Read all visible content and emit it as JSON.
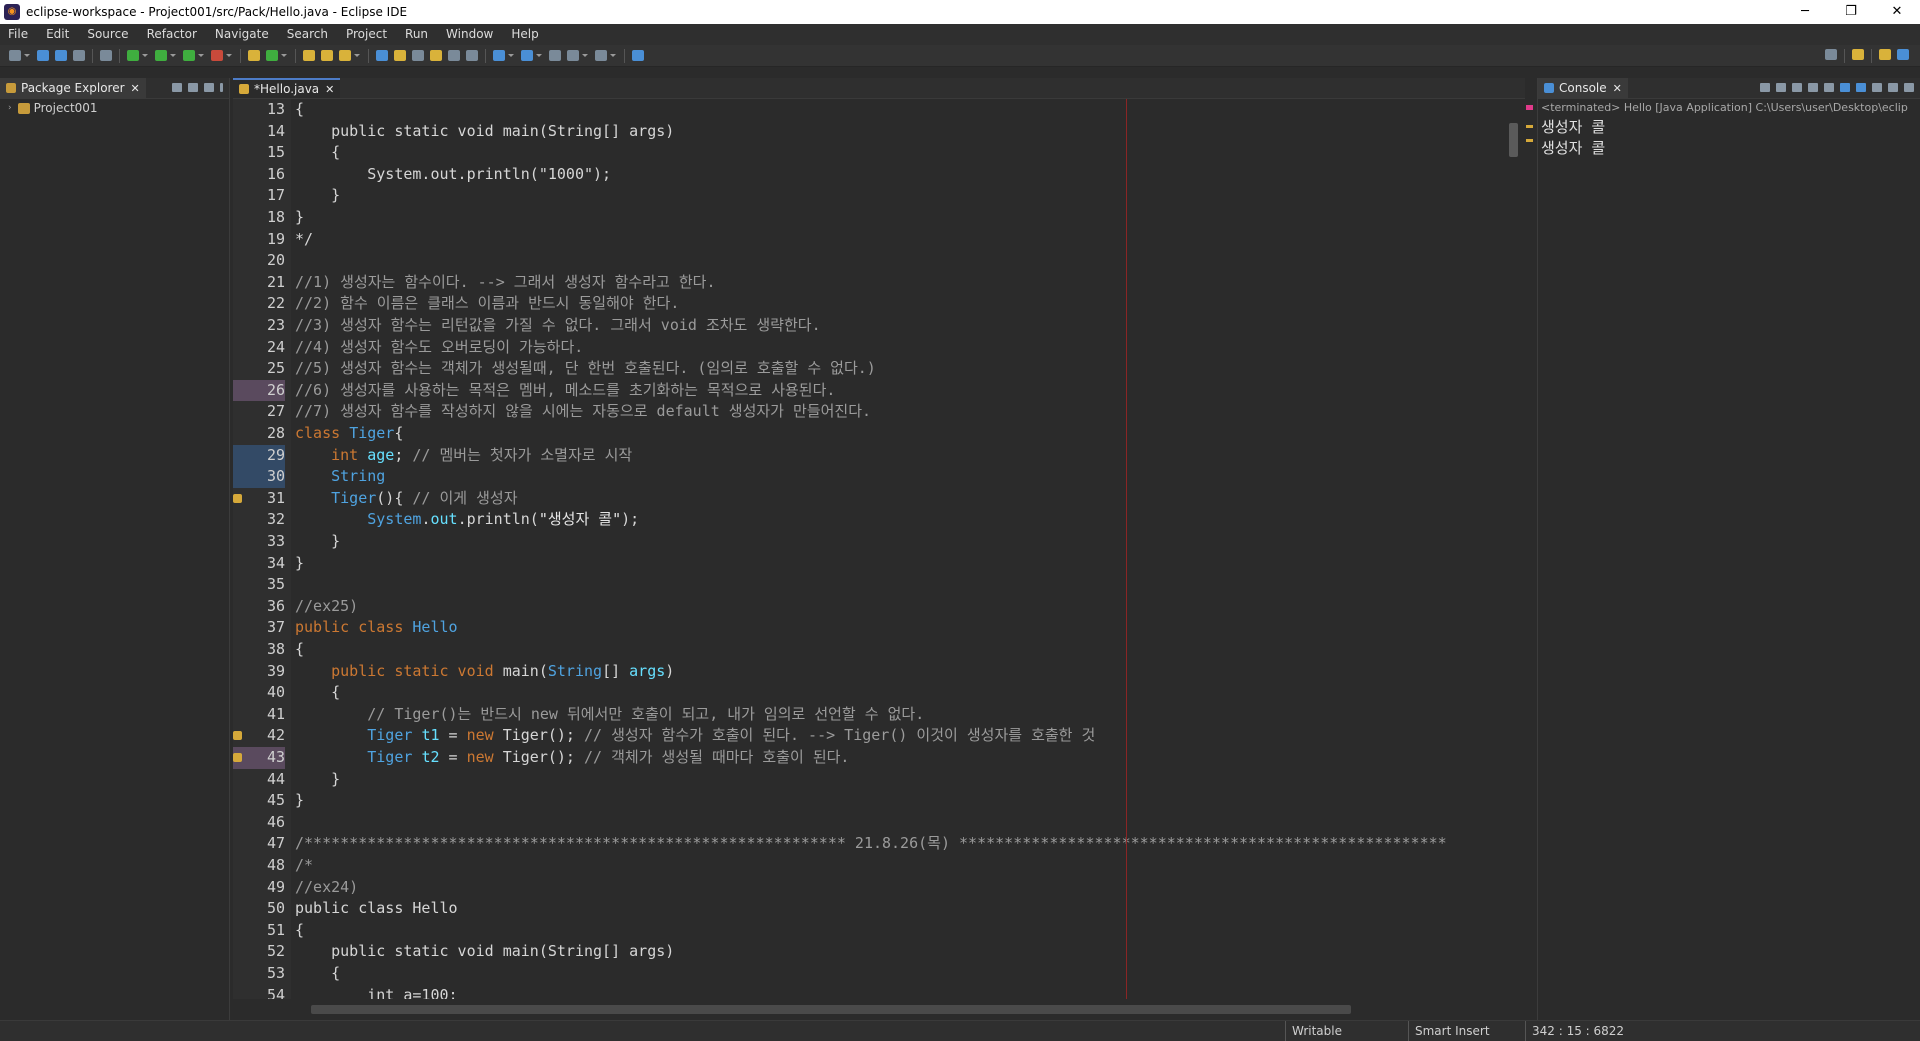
{
  "window": {
    "title": "eclipse-workspace - Project001/src/Pack/Hello.java - Eclipse IDE",
    "min": "─",
    "restore": "❐",
    "close": "✕"
  },
  "menu": [
    "File",
    "Edit",
    "Source",
    "Refactor",
    "Navigate",
    "Search",
    "Project",
    "Run",
    "Window",
    "Help"
  ],
  "package_explorer": {
    "tab_label": "Package Explorer",
    "close": "✕",
    "items": [
      {
        "label": "Project001",
        "arrow": "›"
      }
    ]
  },
  "editor": {
    "tab_label": "*Hello.java",
    "close": "✕",
    "lines": [
      {
        "n": "13",
        "tokens": [
          [
            "plain",
            "{"
          ]
        ]
      },
      {
        "n": "14",
        "tokens": [
          [
            "plain",
            "    public static void main(String[] args)"
          ]
        ]
      },
      {
        "n": "15",
        "tokens": [
          [
            "plain",
            "    {"
          ]
        ]
      },
      {
        "n": "16",
        "tokens": [
          [
            "plain",
            "        System.out.println(\"1000\");"
          ]
        ]
      },
      {
        "n": "17",
        "tokens": [
          [
            "plain",
            "    }"
          ]
        ]
      },
      {
        "n": "18",
        "tokens": [
          [
            "plain",
            "}"
          ]
        ]
      },
      {
        "n": "19",
        "tokens": [
          [
            "plain",
            "*/"
          ]
        ]
      },
      {
        "n": "20",
        "tokens": []
      },
      {
        "n": "21",
        "tokens": [
          [
            "cm",
            "//1) 생성자는 함수이다. --> 그래서 생성자 함수라고 한다."
          ]
        ]
      },
      {
        "n": "22",
        "tokens": [
          [
            "cm",
            "//2) 함수 이름은 클래스 이름과 반드시 동일해야 한다."
          ]
        ]
      },
      {
        "n": "23",
        "tokens": [
          [
            "cm",
            "//3) 생성자 함수는 리턴값을 가질 수 없다. 그래서 void 조차도 생략한다."
          ]
        ]
      },
      {
        "n": "24",
        "tokens": [
          [
            "cm",
            "//4) 생성자 함수도 오버로딩이 가능하다."
          ]
        ]
      },
      {
        "n": "25",
        "tokens": [
          [
            "cm",
            "//5) 생성자 함수는 객체가 생성될때, 단 한번 호출된다. (임의로 호출할 수 없다.)"
          ]
        ]
      },
      {
        "n": "26",
        "hl": "hl",
        "tokens": [
          [
            "cm",
            "//6) 생성자를 사용하는 목적은 멤버, 메소드를 초기화하는 목적으로 사용된다."
          ]
        ]
      },
      {
        "n": "27",
        "tokens": [
          [
            "cm",
            "//7) 생성자 함수를 작성하지 않을 시에는 자동으로 default 생성자가 만들어진다."
          ]
        ]
      },
      {
        "n": "28",
        "tokens": [
          [
            "kw",
            "class "
          ],
          [
            "cls",
            "Tiger"
          ],
          [
            "plain",
            "{"
          ]
        ]
      },
      {
        "n": "29",
        "hl": "hl2",
        "tokens": [
          [
            "plain",
            "    "
          ],
          [
            "kw",
            "int "
          ],
          [
            "fld",
            "age"
          ],
          [
            "plain",
            "; "
          ],
          [
            "cm",
            "// 멤버는 첫자가 소멸자로 시작"
          ]
        ]
      },
      {
        "n": "30",
        "hl": "hl2",
        "tokens": [
          [
            "plain",
            "    "
          ],
          [
            "cls",
            "String"
          ]
        ]
      },
      {
        "n": "31",
        "ann": true,
        "tokens": [
          [
            "plain",
            "    "
          ],
          [
            "cls",
            "Tiger"
          ],
          [
            "plain",
            "(){ "
          ],
          [
            "cm",
            "// 이게 생성자"
          ]
        ]
      },
      {
        "n": "32",
        "tokens": [
          [
            "plain",
            "        "
          ],
          [
            "cls",
            "System"
          ],
          [
            "plain",
            "."
          ],
          [
            "fld",
            "out"
          ],
          [
            "plain",
            ".println("
          ],
          [
            "str",
            "\"생성자 콜\""
          ],
          [
            "plain",
            ");"
          ]
        ]
      },
      {
        "n": "33",
        "tokens": [
          [
            "plain",
            "    }"
          ]
        ]
      },
      {
        "n": "34",
        "tokens": [
          [
            "plain",
            "}"
          ]
        ]
      },
      {
        "n": "35",
        "tokens": []
      },
      {
        "n": "36",
        "tokens": [
          [
            "cm",
            "//ex25)"
          ]
        ]
      },
      {
        "n": "37",
        "tokens": [
          [
            "kw",
            "public class "
          ],
          [
            "cls",
            "Hello"
          ]
        ]
      },
      {
        "n": "38",
        "tokens": [
          [
            "plain",
            "{"
          ]
        ]
      },
      {
        "n": "39",
        "tokens": [
          [
            "plain",
            "    "
          ],
          [
            "kw",
            "public static void "
          ],
          [
            "plain",
            "main("
          ],
          [
            "cls",
            "String"
          ],
          [
            "plain",
            "[] "
          ],
          [
            "fld",
            "args"
          ],
          [
            "plain",
            ")"
          ]
        ]
      },
      {
        "n": "40",
        "tokens": [
          [
            "plain",
            "    {"
          ]
        ]
      },
      {
        "n": "41",
        "tokens": [
          [
            "plain",
            "        "
          ],
          [
            "cm",
            "// Tiger()는 반드시 new 뒤에서만 호출이 되고, 내가 임의로 선언할 수 없다."
          ]
        ]
      },
      {
        "n": "42",
        "ann": true,
        "tokens": [
          [
            "plain",
            "        "
          ],
          [
            "cls",
            "Tiger "
          ],
          [
            "fld",
            "t1"
          ],
          [
            "plain",
            " = "
          ],
          [
            "kw",
            "new "
          ],
          [
            "plain",
            "Tiger(); "
          ],
          [
            "cm",
            "// 생성자 함수가 호출이 된다. --> Tiger() 이것이 생성자를 호출한 것"
          ]
        ]
      },
      {
        "n": "43",
        "hl": "hl",
        "ann": true,
        "tokens": [
          [
            "plain",
            "        "
          ],
          [
            "cls",
            "Tiger "
          ],
          [
            "fld",
            "t2"
          ],
          [
            "plain",
            " = "
          ],
          [
            "kw",
            "new "
          ],
          [
            "plain",
            "Tiger(); "
          ],
          [
            "cm",
            "// 객체가 생성될 때마다 호출이 된다."
          ]
        ]
      },
      {
        "n": "44",
        "tokens": [
          [
            "plain",
            "    }"
          ]
        ]
      },
      {
        "n": "45",
        "tokens": [
          [
            "plain",
            "}"
          ]
        ]
      },
      {
        "n": "46",
        "tokens": []
      },
      {
        "n": "47",
        "tokens": [
          [
            "cm",
            "/************************************************************ 21.8.26(목) ******************************************************"
          ]
        ]
      },
      {
        "n": "48",
        "tokens": [
          [
            "cm",
            "/*"
          ]
        ]
      },
      {
        "n": "49",
        "tokens": [
          [
            "cm",
            "//ex24)"
          ]
        ]
      },
      {
        "n": "50",
        "tokens": [
          [
            "plain",
            "public class Hello"
          ]
        ]
      },
      {
        "n": "51",
        "tokens": [
          [
            "plain",
            "{"
          ]
        ]
      },
      {
        "n": "52",
        "tokens": [
          [
            "plain",
            "    public static void main(String[] args)"
          ]
        ]
      },
      {
        "n": "53",
        "tokens": [
          [
            "plain",
            "    {"
          ]
        ]
      },
      {
        "n": "54",
        "tokens": [
          [
            "plain",
            "        int a=100;"
          ]
        ]
      }
    ]
  },
  "console": {
    "tab_label": "Console",
    "close": "✕",
    "status": "<terminated> Hello [Java Application] C:\\Users\\user\\Desktop\\eclip",
    "lines": [
      "생성자 콜",
      "생성자 콜"
    ]
  },
  "statusbar": {
    "writable": "Writable",
    "insert_mode": "Smart Insert",
    "position": "342 : 15 : 6822"
  },
  "colors": {
    "keyword": "#cc7832",
    "class": "#4fa3e0",
    "field": "#66e0ff",
    "comment": "#9b9b9b",
    "background": "#2b2b2b"
  }
}
